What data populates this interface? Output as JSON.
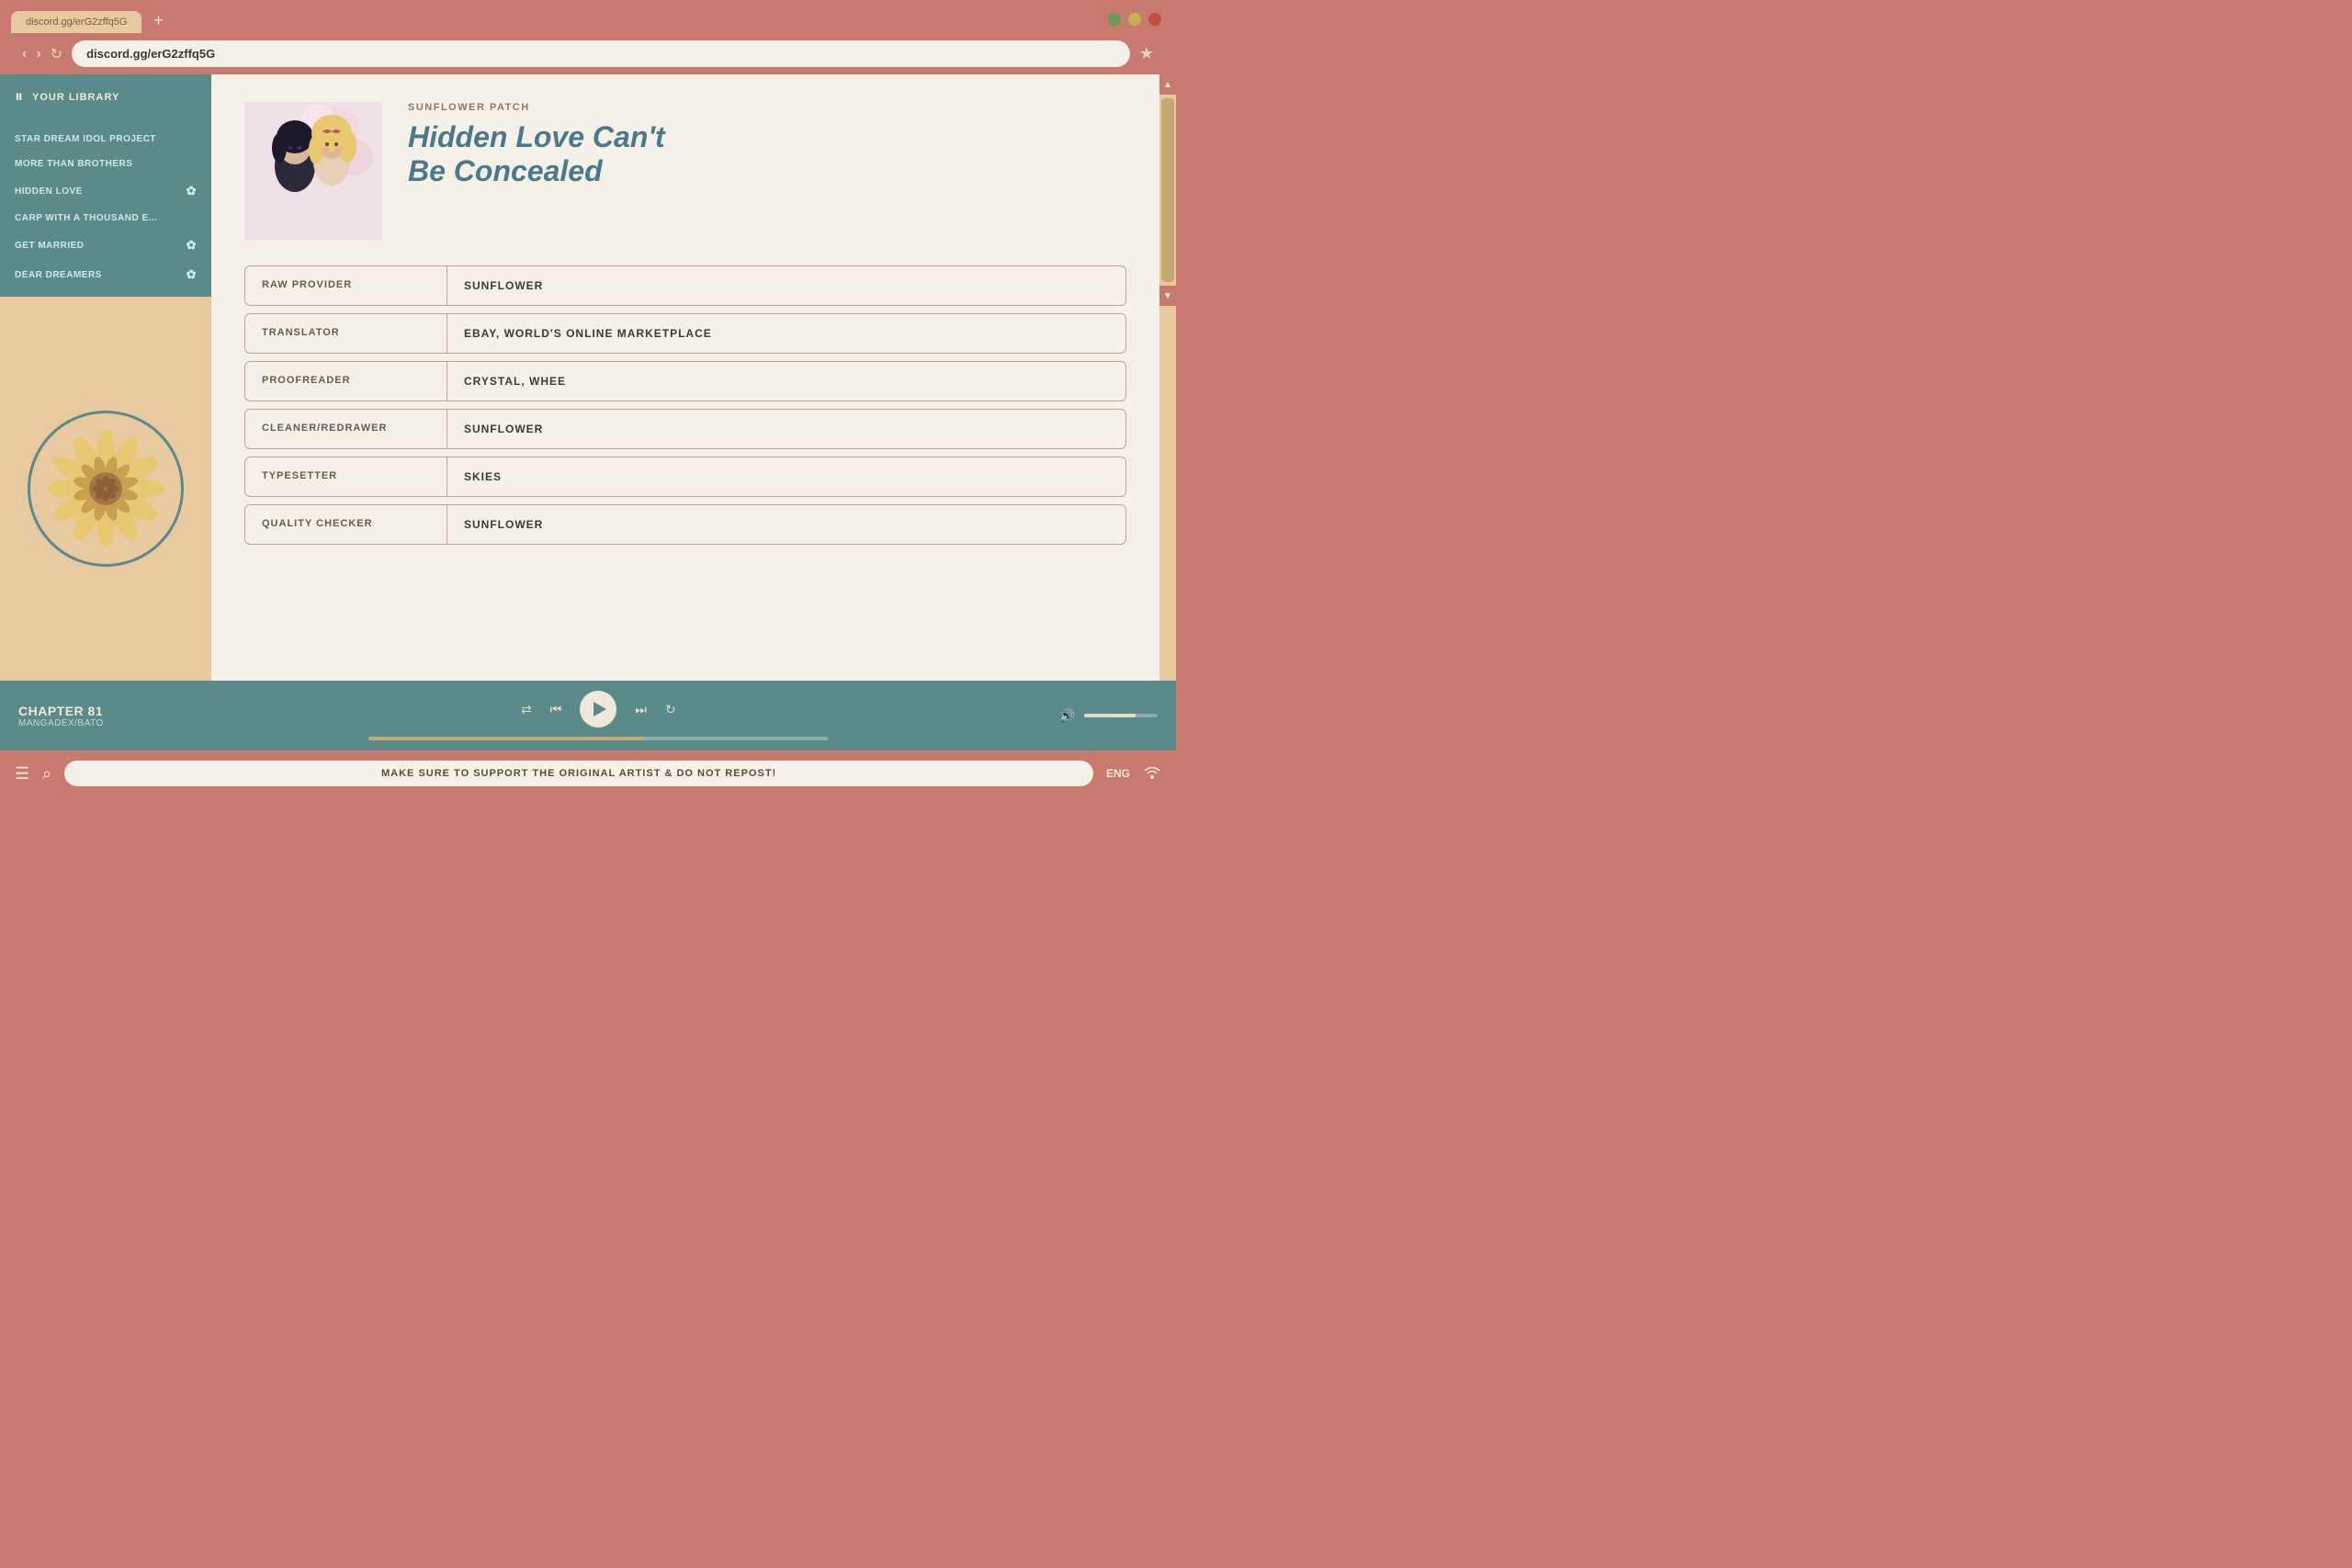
{
  "browser": {
    "tab_label": "discord.gg/erG2zffq5G",
    "tab_add": "+",
    "address_url": "discord.gg/erG2zffq5G",
    "bookmark_char": "★",
    "nav_back": "‹",
    "nav_forward": "›",
    "nav_reload": "↻"
  },
  "window_controls": {
    "green": "green",
    "yellow": "yellow",
    "red": "red"
  },
  "sidebar": {
    "title": "YOUR LIBRARY",
    "items": [
      {
        "label": "STAR DREAM IDOL PROJECT",
        "bookmarked": false
      },
      {
        "label": "MORE THAN BROTHERS",
        "bookmarked": false
      },
      {
        "label": "HIDDEN LOVE",
        "bookmarked": true
      },
      {
        "label": "CARP WITH A THOUSAND E...",
        "bookmarked": false
      },
      {
        "label": "GET MARRIED",
        "bookmarked": true
      },
      {
        "label": "DEAR DREAMERS",
        "bookmarked": true
      }
    ]
  },
  "manga": {
    "group": "SUNFLOWER PATCH",
    "title_line1": "Hidden Love Can't",
    "title_line2": "Be Concealed",
    "credits": [
      {
        "label": "RAW PROVIDER",
        "value": "SUNFLOWER"
      },
      {
        "label": "TRANSLATOR",
        "value": "EBAY, WORLD'S ONLINE MARKETPLACE"
      },
      {
        "label": "PROOFREADER",
        "value": "CRYSTAL, WHEE"
      },
      {
        "label": "CLEANER/REDRAWER",
        "value": "SUNFLOWER"
      },
      {
        "label": "TYPESETTER",
        "value": "SKIES"
      },
      {
        "label": "QUALITY CHECKER",
        "value": "SUNFLOWER"
      }
    ]
  },
  "player": {
    "chapter_title": "CHAPTER 81",
    "chapter_source": "MANGADEX/BATO",
    "progress_percent": 60,
    "volume_percent": 70
  },
  "status_bar": {
    "message": "MAKE SURE TO SUPPORT THE ORIGINAL ARTIST & DO NOT REPOST!",
    "language": "ENG"
  }
}
